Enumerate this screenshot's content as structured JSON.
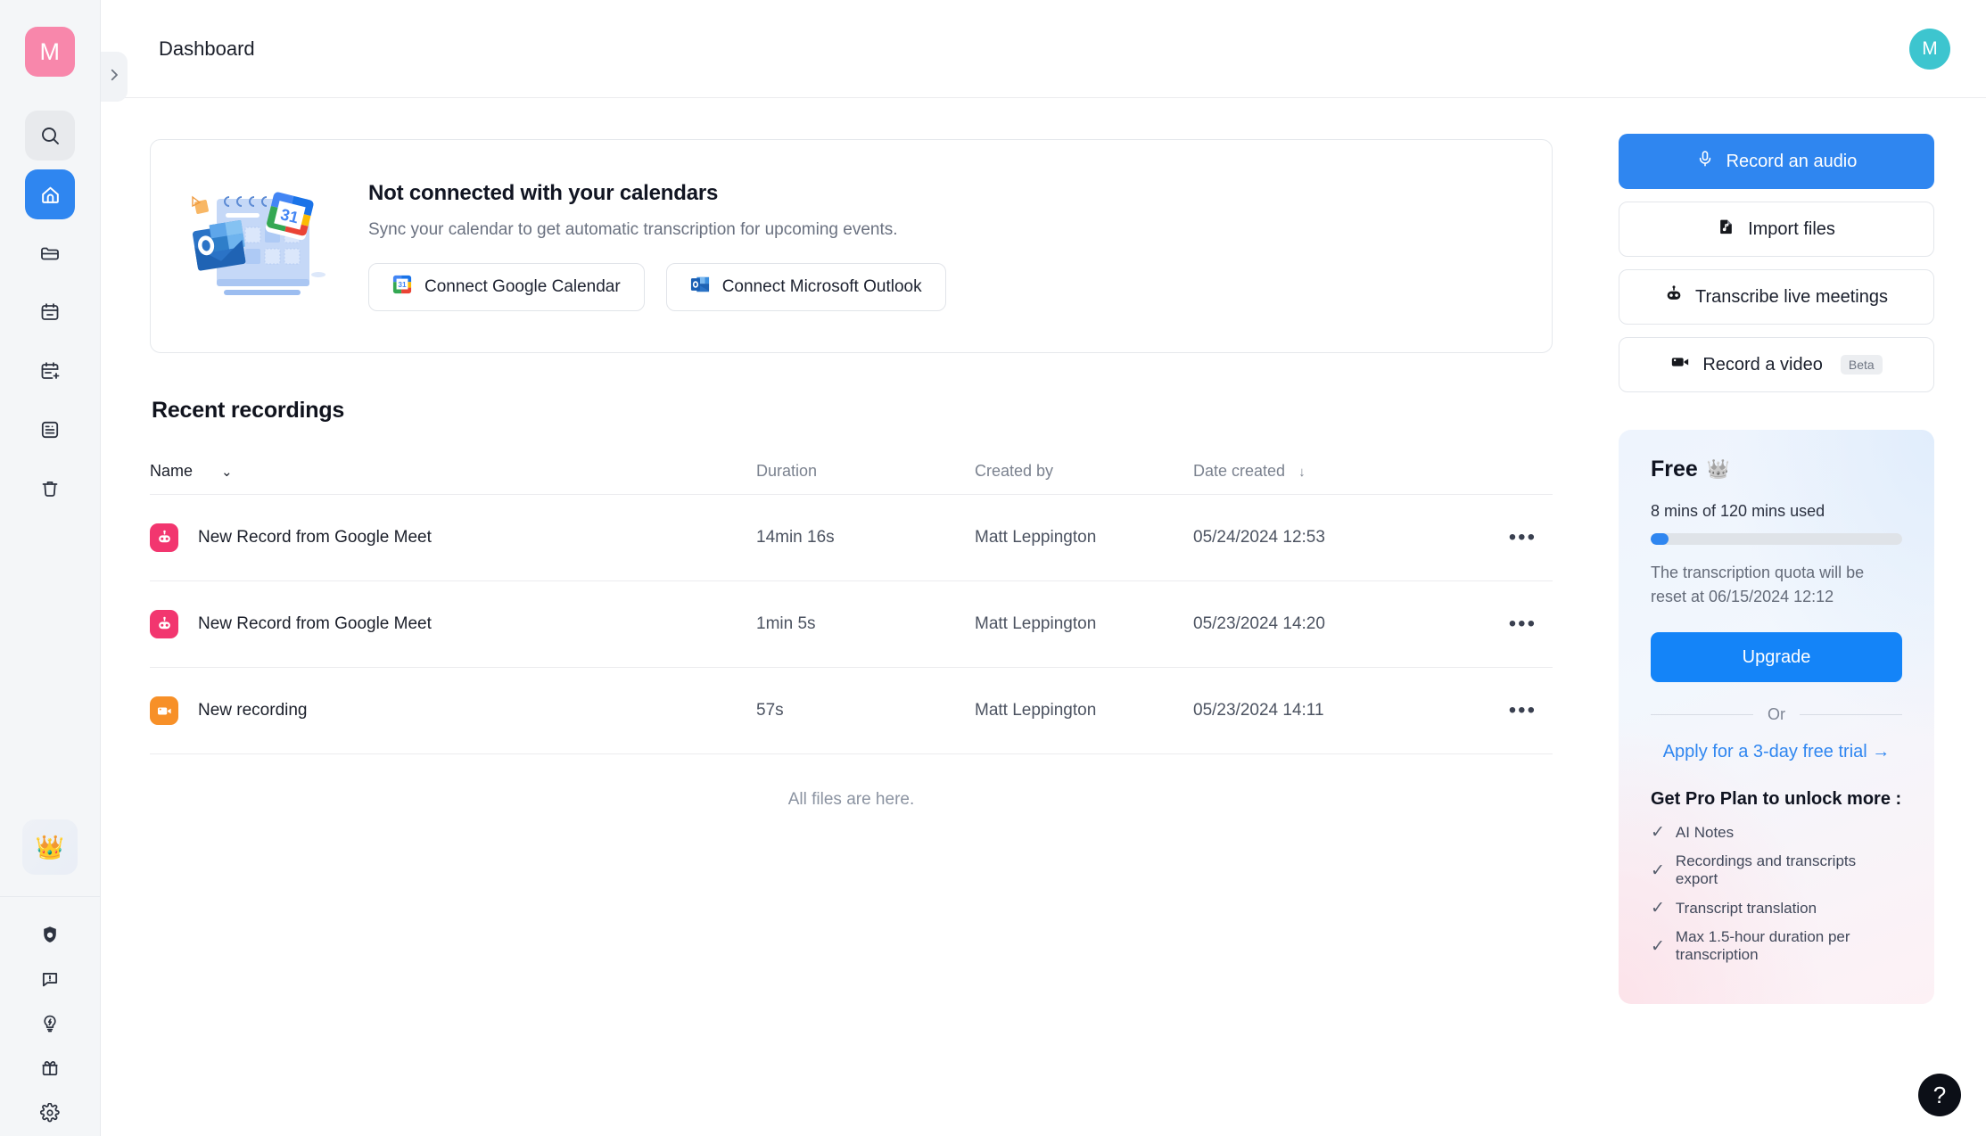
{
  "sidebar": {
    "logo_label": "M",
    "logo_color": "#f887ab",
    "items": [
      {
        "name": "search-icon",
        "label": "Search"
      },
      {
        "name": "home-icon",
        "label": "Home"
      },
      {
        "name": "folder-icon",
        "label": "Folders"
      },
      {
        "name": "calendar-icon",
        "label": "Calendar"
      },
      {
        "name": "calendar-add-icon",
        "label": "Schedule"
      },
      {
        "name": "notes-icon",
        "label": "Notes"
      },
      {
        "name": "trash-icon",
        "label": "Trash"
      }
    ],
    "crown_label": "👑",
    "bottom_items": [
      {
        "name": "shield-icon",
        "label": "Privacy"
      },
      {
        "name": "feedback-icon",
        "label": "Feedback"
      },
      {
        "name": "lightbulb-icon",
        "label": "Tips"
      },
      {
        "name": "gift-icon",
        "label": "Gift"
      },
      {
        "name": "gear-icon",
        "label": "Settings"
      }
    ],
    "collapse_label": "›"
  },
  "header": {
    "title": "Dashboard",
    "avatar_initial": "M",
    "avatar_color": "#3dc5cf"
  },
  "banner": {
    "title": "Not connected with your calendars",
    "subtitle": "Sync your calendar to get automatic transcription for upcoming events.",
    "google_button": "Connect Google Calendar",
    "outlook_button": "Connect Microsoft Outlook",
    "illustration_date": "31",
    "illustration_outlook_letter": "O"
  },
  "recent": {
    "section_title": "Recent recordings",
    "columns": {
      "name": "Name",
      "name_sort": "⌄",
      "duration": "Duration",
      "created_by": "Created by",
      "date_created": "Date created",
      "date_sort": "↓"
    },
    "rows": [
      {
        "icon": "bot-icon",
        "icon_color": "#f2366f",
        "name": "New Record from Google Meet",
        "duration": "14min 16s",
        "created_by": "Matt Leppington",
        "date_created": "05/24/2024 12:53",
        "actions": "•••"
      },
      {
        "icon": "bot-icon",
        "icon_color": "#f2366f",
        "name": "New Record from Google Meet",
        "duration": "1min 5s",
        "created_by": "Matt Leppington",
        "date_created": "05/23/2024 14:20",
        "actions": "•••"
      },
      {
        "icon": "video-icon",
        "icon_color": "#f79028",
        "name": "New recording",
        "duration": "57s",
        "created_by": "Matt Leppington",
        "date_created": "05/23/2024 14:11",
        "actions": "•••"
      }
    ],
    "footer_note": "All files are here."
  },
  "actions": {
    "record_audio": "Record an audio",
    "import_files": "Import files",
    "transcribe_live": "Transcribe live meetings",
    "record_video": "Record a video",
    "record_video_badge": "Beta",
    "primary_color": "#2f86f0"
  },
  "plan": {
    "name": "Free",
    "crown": "👑",
    "usage_text": "8 mins of 120 mins used",
    "usage_percent": 7,
    "reset_text": "The transcription quota will be reset at 06/15/2024 12:12",
    "upgrade_button": "Upgrade",
    "or_label": "Or",
    "trial_link": "Apply for a 3-day free trial  →",
    "pro_heading": "Get Pro Plan to unlock more :",
    "pro_features": [
      "AI Notes",
      "Recordings and transcripts export",
      "Transcript translation",
      "Max 1.5-hour duration per transcription"
    ]
  },
  "help": {
    "label": "?"
  }
}
